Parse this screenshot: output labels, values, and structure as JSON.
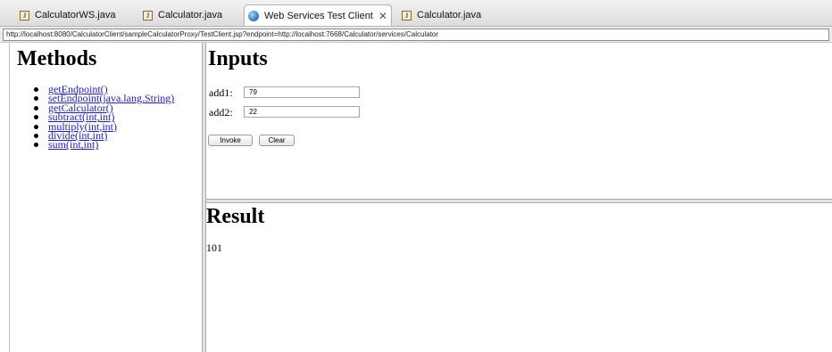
{
  "tabs": [
    {
      "label": "CalculatorWS.java",
      "icon": "java-file-icon"
    },
    {
      "label": "Calculator.java",
      "icon": "java-file-icon"
    },
    {
      "label": "Web Services Test Client",
      "icon": "globe-icon",
      "active": true,
      "close": "✕"
    },
    {
      "label": "Calculator.java",
      "icon": "java-file-icon"
    }
  ],
  "address": {
    "url": "http://localhost:8080/CalculatorClient/sampleCalculatorProxy/TestClient.jsp?endpoint=http://localhost:7668/Calculator/services/Calculator"
  },
  "methods": {
    "title": "Methods",
    "items": [
      "getEndpoint()",
      "setEndpoint(java.lang.String)",
      "getCalculator()",
      "subtract(int,int)",
      "multiply(int,int)",
      "divide(int,int)",
      "sum(int,int)"
    ]
  },
  "inputs": {
    "title": "Inputs",
    "add1_label": "add1:",
    "add1_value": "79",
    "add2_label": "add2:",
    "add2_value": "22",
    "invoke_label": "Invoke",
    "clear_label": "Clear"
  },
  "result": {
    "title": "Result",
    "value": "101"
  },
  "colors": {
    "link": "#1a1aee",
    "tab_bar": "#dcdcdc"
  }
}
